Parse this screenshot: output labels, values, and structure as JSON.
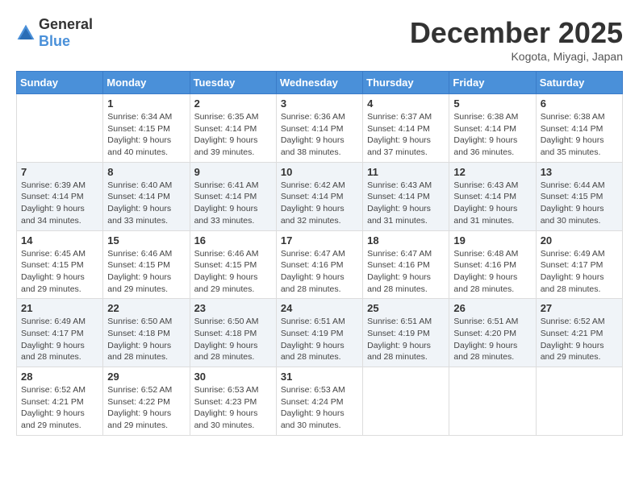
{
  "logo": {
    "general": "General",
    "blue": "Blue"
  },
  "title": "December 2025",
  "location": "Kogota, Miyagi, Japan",
  "weekdays": [
    "Sunday",
    "Monday",
    "Tuesday",
    "Wednesday",
    "Thursday",
    "Friday",
    "Saturday"
  ],
  "weeks": [
    [
      {
        "day": "",
        "sunrise": "",
        "sunset": "",
        "daylight": ""
      },
      {
        "day": "1",
        "sunrise": "Sunrise: 6:34 AM",
        "sunset": "Sunset: 4:15 PM",
        "daylight": "Daylight: 9 hours and 40 minutes."
      },
      {
        "day": "2",
        "sunrise": "Sunrise: 6:35 AM",
        "sunset": "Sunset: 4:14 PM",
        "daylight": "Daylight: 9 hours and 39 minutes."
      },
      {
        "day": "3",
        "sunrise": "Sunrise: 6:36 AM",
        "sunset": "Sunset: 4:14 PM",
        "daylight": "Daylight: 9 hours and 38 minutes."
      },
      {
        "day": "4",
        "sunrise": "Sunrise: 6:37 AM",
        "sunset": "Sunset: 4:14 PM",
        "daylight": "Daylight: 9 hours and 37 minutes."
      },
      {
        "day": "5",
        "sunrise": "Sunrise: 6:38 AM",
        "sunset": "Sunset: 4:14 PM",
        "daylight": "Daylight: 9 hours and 36 minutes."
      },
      {
        "day": "6",
        "sunrise": "Sunrise: 6:38 AM",
        "sunset": "Sunset: 4:14 PM",
        "daylight": "Daylight: 9 hours and 35 minutes."
      }
    ],
    [
      {
        "day": "7",
        "sunrise": "Sunrise: 6:39 AM",
        "sunset": "Sunset: 4:14 PM",
        "daylight": "Daylight: 9 hours and 34 minutes."
      },
      {
        "day": "8",
        "sunrise": "Sunrise: 6:40 AM",
        "sunset": "Sunset: 4:14 PM",
        "daylight": "Daylight: 9 hours and 33 minutes."
      },
      {
        "day": "9",
        "sunrise": "Sunrise: 6:41 AM",
        "sunset": "Sunset: 4:14 PM",
        "daylight": "Daylight: 9 hours and 33 minutes."
      },
      {
        "day": "10",
        "sunrise": "Sunrise: 6:42 AM",
        "sunset": "Sunset: 4:14 PM",
        "daylight": "Daylight: 9 hours and 32 minutes."
      },
      {
        "day": "11",
        "sunrise": "Sunrise: 6:43 AM",
        "sunset": "Sunset: 4:14 PM",
        "daylight": "Daylight: 9 hours and 31 minutes."
      },
      {
        "day": "12",
        "sunrise": "Sunrise: 6:43 AM",
        "sunset": "Sunset: 4:14 PM",
        "daylight": "Daylight: 9 hours and 31 minutes."
      },
      {
        "day": "13",
        "sunrise": "Sunrise: 6:44 AM",
        "sunset": "Sunset: 4:15 PM",
        "daylight": "Daylight: 9 hours and 30 minutes."
      }
    ],
    [
      {
        "day": "14",
        "sunrise": "Sunrise: 6:45 AM",
        "sunset": "Sunset: 4:15 PM",
        "daylight": "Daylight: 9 hours and 29 minutes."
      },
      {
        "day": "15",
        "sunrise": "Sunrise: 6:46 AM",
        "sunset": "Sunset: 4:15 PM",
        "daylight": "Daylight: 9 hours and 29 minutes."
      },
      {
        "day": "16",
        "sunrise": "Sunrise: 6:46 AM",
        "sunset": "Sunset: 4:15 PM",
        "daylight": "Daylight: 9 hours and 29 minutes."
      },
      {
        "day": "17",
        "sunrise": "Sunrise: 6:47 AM",
        "sunset": "Sunset: 4:16 PM",
        "daylight": "Daylight: 9 hours and 28 minutes."
      },
      {
        "day": "18",
        "sunrise": "Sunrise: 6:47 AM",
        "sunset": "Sunset: 4:16 PM",
        "daylight": "Daylight: 9 hours and 28 minutes."
      },
      {
        "day": "19",
        "sunrise": "Sunrise: 6:48 AM",
        "sunset": "Sunset: 4:16 PM",
        "daylight": "Daylight: 9 hours and 28 minutes."
      },
      {
        "day": "20",
        "sunrise": "Sunrise: 6:49 AM",
        "sunset": "Sunset: 4:17 PM",
        "daylight": "Daylight: 9 hours and 28 minutes."
      }
    ],
    [
      {
        "day": "21",
        "sunrise": "Sunrise: 6:49 AM",
        "sunset": "Sunset: 4:17 PM",
        "daylight": "Daylight: 9 hours and 28 minutes."
      },
      {
        "day": "22",
        "sunrise": "Sunrise: 6:50 AM",
        "sunset": "Sunset: 4:18 PM",
        "daylight": "Daylight: 9 hours and 28 minutes."
      },
      {
        "day": "23",
        "sunrise": "Sunrise: 6:50 AM",
        "sunset": "Sunset: 4:18 PM",
        "daylight": "Daylight: 9 hours and 28 minutes."
      },
      {
        "day": "24",
        "sunrise": "Sunrise: 6:51 AM",
        "sunset": "Sunset: 4:19 PM",
        "daylight": "Daylight: 9 hours and 28 minutes."
      },
      {
        "day": "25",
        "sunrise": "Sunrise: 6:51 AM",
        "sunset": "Sunset: 4:19 PM",
        "daylight": "Daylight: 9 hours and 28 minutes."
      },
      {
        "day": "26",
        "sunrise": "Sunrise: 6:51 AM",
        "sunset": "Sunset: 4:20 PM",
        "daylight": "Daylight: 9 hours and 28 minutes."
      },
      {
        "day": "27",
        "sunrise": "Sunrise: 6:52 AM",
        "sunset": "Sunset: 4:21 PM",
        "daylight": "Daylight: 9 hours and 29 minutes."
      }
    ],
    [
      {
        "day": "28",
        "sunrise": "Sunrise: 6:52 AM",
        "sunset": "Sunset: 4:21 PM",
        "daylight": "Daylight: 9 hours and 29 minutes."
      },
      {
        "day": "29",
        "sunrise": "Sunrise: 6:52 AM",
        "sunset": "Sunset: 4:22 PM",
        "daylight": "Daylight: 9 hours and 29 minutes."
      },
      {
        "day": "30",
        "sunrise": "Sunrise: 6:53 AM",
        "sunset": "Sunset: 4:23 PM",
        "daylight": "Daylight: 9 hours and 30 minutes."
      },
      {
        "day": "31",
        "sunrise": "Sunrise: 6:53 AM",
        "sunset": "Sunset: 4:24 PM",
        "daylight": "Daylight: 9 hours and 30 minutes."
      },
      {
        "day": "",
        "sunrise": "",
        "sunset": "",
        "daylight": ""
      },
      {
        "day": "",
        "sunrise": "",
        "sunset": "",
        "daylight": ""
      },
      {
        "day": "",
        "sunrise": "",
        "sunset": "",
        "daylight": ""
      }
    ]
  ]
}
